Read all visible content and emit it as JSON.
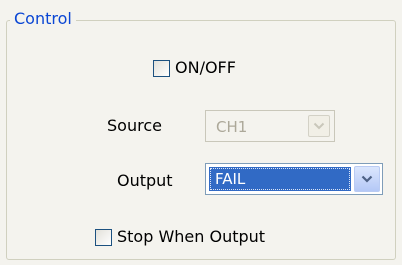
{
  "group": {
    "title": "Control"
  },
  "on_off": {
    "label": "ON/OFF",
    "checked": false
  },
  "source": {
    "label": "Source",
    "value": "CH1",
    "enabled": false
  },
  "output": {
    "label": "Output",
    "value": "FAIL",
    "selected": true
  },
  "stop_when_output": {
    "label": "Stop When Output",
    "checked": false
  },
  "icons": {
    "source_dropdown": "chevron-down-icon",
    "output_dropdown": "chevron-down-icon"
  },
  "colors": {
    "group_title": "#0a46d4",
    "panel_background": "#f4f3ee",
    "selection_highlight": "#316ac5",
    "checkbox_border": "#1c5180",
    "disabled_text": "#aca899"
  }
}
